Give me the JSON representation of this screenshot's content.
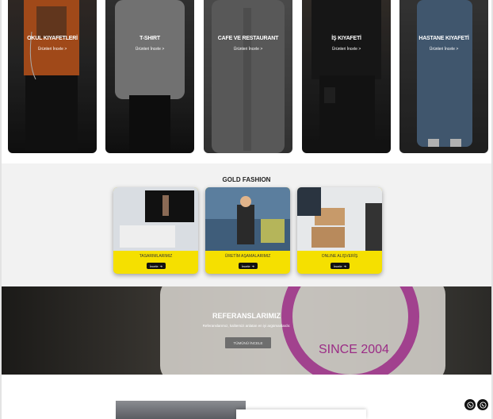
{
  "categories": [
    {
      "title": "OKUL KIYAFETLERİ",
      "link": "Ürünleri İncele >"
    },
    {
      "title": "T-SHIRT",
      "link": "Ürünleri İncele >"
    },
    {
      "title": "CAFE VE RESTAURANT",
      "link": "Ürünleri İncele >"
    },
    {
      "title": "İŞ KIYAFETİ",
      "link": "Ürünleri İncele >"
    },
    {
      "title": "HASTANE KIYAFETİ",
      "link": "Ürünleri İncele >"
    }
  ],
  "gold": {
    "title": "GOLD FASHION",
    "cards": [
      {
        "label": "TASARIMLARIMIZ",
        "button": "İncele"
      },
      {
        "label": "ÜRETİM AŞAMALARIMIZ",
        "button": "İncele"
      },
      {
        "label": "ONLINE ALIŞVERİŞ",
        "button": "İncele"
      }
    ]
  },
  "references": {
    "title": "REFERANSLARIMIZ",
    "subtitle": "Referanslarımız, kalitemizi anlatan en iyi argümanlardır.",
    "button": "TÜMÜNÜ İNCELE",
    "shirt_text": "SINCE 2004"
  },
  "colors": {
    "accent": "#f5e000",
    "dark": "#111111"
  }
}
